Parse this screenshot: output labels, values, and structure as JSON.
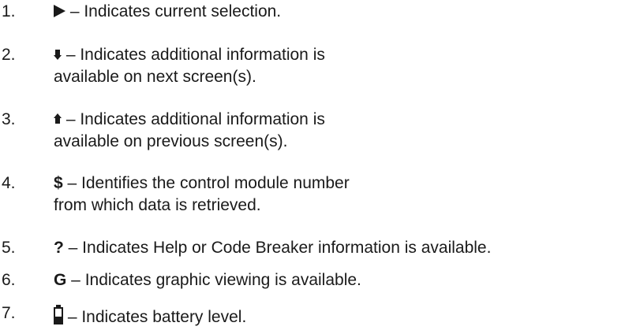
{
  "items": [
    {
      "number": "1.",
      "symbol": "current-selection-triangle-icon",
      "line1": " – Indicates current selection.",
      "line2": ""
    },
    {
      "number": "2.",
      "symbol": "arrow-down-icon",
      "line1": " – Indicates additional information is",
      "line2": "available on next screen(s)."
    },
    {
      "number": "3.",
      "symbol": "arrow-up-icon",
      "line1": " – Indicates additional information is",
      "line2": "available on previous screen(s)."
    },
    {
      "number": "4.",
      "symbol_text": "$",
      "line1": " – Identifies the control module number",
      "line2": "from which data is retrieved."
    },
    {
      "number": "5.",
      "symbol_text": "?",
      "line1": " – Indicates Help or Code Breaker information is available.",
      "line2": ""
    },
    {
      "number": "6.",
      "symbol_text": "G",
      "line1": " – Indicates graphic viewing is available.",
      "line2": ""
    },
    {
      "number": "7.",
      "symbol": "battery-icon",
      "battery_level": 0.45,
      "line1": " – Indicates battery level.",
      "line2": ""
    }
  ]
}
